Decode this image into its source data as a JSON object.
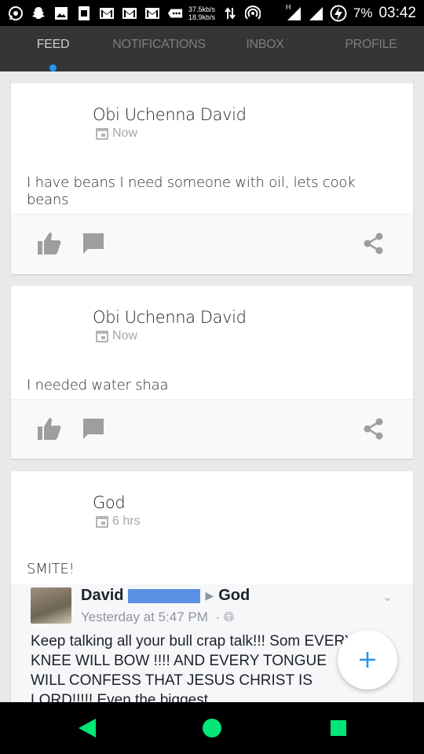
{
  "status_bar": {
    "rate_up": "37.5kb/s",
    "rate_down": "18.9kb/s",
    "network_letter": "H",
    "battery": "7%",
    "time": "03:42",
    "icons": [
      "whatsapp-icon",
      "snapchat-icon",
      "gallery-icon",
      "sim-icon",
      "gmail-icon",
      "gmail-icon",
      "gmail-icon",
      "more-notifications-icon",
      "data-arrows-icon",
      "hotspot-icon",
      "signal-icon",
      "signal-icon",
      "battery-charging-icon"
    ]
  },
  "tabs": [
    {
      "label": "FEED",
      "active": true
    },
    {
      "label": "NOTIFICATIONS",
      "active": false
    },
    {
      "label": "INBOX",
      "active": false
    },
    {
      "label": "PROFILE",
      "active": false
    }
  ],
  "posts": [
    {
      "author": "Obi Uchenna David",
      "time": "Now",
      "text": "I have beans I need someone with oil, lets cook beans"
    },
    {
      "author": "Obi Uchenna David",
      "time": "Now",
      "text": "I needed water shaa"
    },
    {
      "author": "God",
      "time": "6 hrs",
      "text": "SMITE!"
    }
  ],
  "embed": {
    "name": "David",
    "target": "God",
    "timestamp": "Yesterday at 5:47 PM",
    "body": "Keep talking all your bull crap talk!!! Som EVERY KNEE WILL BOW !!!! AND EVERY TONGUE WILL CONFESS THAT JESUS CHRIST IS LORD!!!!! Even the biggest"
  },
  "colors": {
    "accent": "#2196f3",
    "nav_green": "#00e676",
    "tab_bar": "#353535",
    "icon_gray": "#9e9e9e"
  }
}
